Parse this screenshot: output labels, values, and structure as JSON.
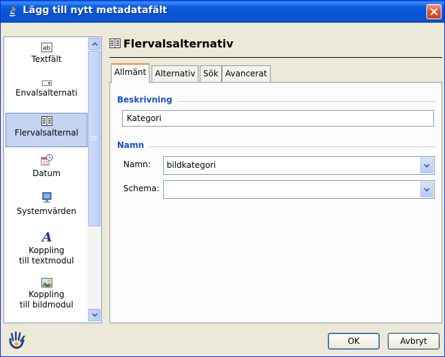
{
  "window": {
    "title": "Lägg till nytt metadatafält"
  },
  "sidebar": {
    "items": [
      {
        "label": "Textfält",
        "icon": "text-field-icon"
      },
      {
        "label": "Envalsalternati",
        "icon": "single-choice-icon"
      },
      {
        "label": "Flervalsalternal",
        "icon": "multi-choice-icon",
        "selected": true
      },
      {
        "label": "Datum",
        "icon": "calendar-icon"
      },
      {
        "label": "Systemvärden",
        "icon": "computer-icon"
      },
      {
        "label": "Koppling\ntill textmodul",
        "line1": "Koppling",
        "line2": "till textmodul",
        "icon": "text-module-icon"
      },
      {
        "label": "Koppling\ntill bildmodul",
        "line1": "Koppling",
        "line2": "till bildmodul",
        "icon": "image-module-icon"
      }
    ]
  },
  "panel": {
    "title": "Flervalsalternativ",
    "tabs": [
      {
        "label": "Allmänt",
        "active": true
      },
      {
        "label": "Alternativ"
      },
      {
        "label": "Sök"
      },
      {
        "label": "Avancerat"
      }
    ],
    "description_group": {
      "label": "Beskrivning",
      "value": "Kategori"
    },
    "name_group": {
      "label": "Namn",
      "name_label": "Namn:",
      "name_value": "bildkategori",
      "schema_label": "Schema:",
      "schema_value": ""
    }
  },
  "buttons": {
    "ok": "OK",
    "cancel": "Avbryt"
  },
  "colors": {
    "titlebar": "#0654d6",
    "group_label": "#1a50c8",
    "selection": "#c4d4f1"
  }
}
